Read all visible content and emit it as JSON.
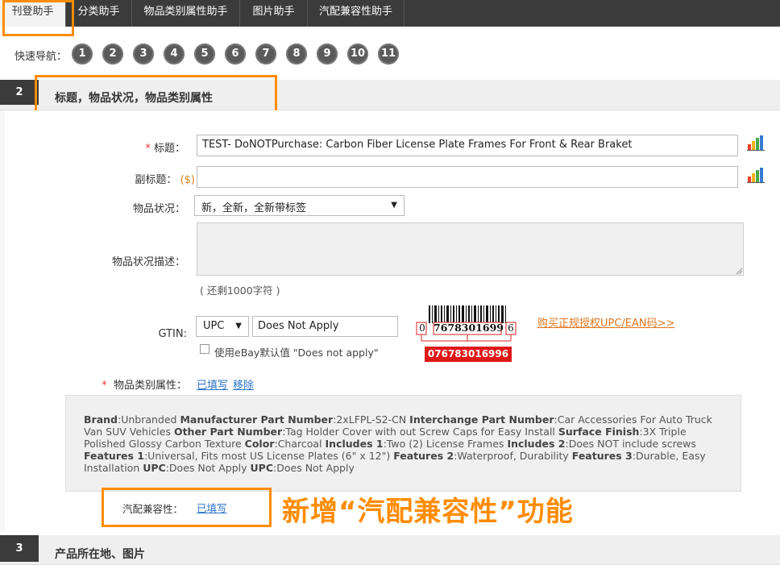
{
  "tabs": [
    {
      "label": "刊登助手",
      "active": true
    },
    {
      "label": "分类助手"
    },
    {
      "label": "物品类别属性助手"
    },
    {
      "label": "图片助手"
    },
    {
      "label": "汽配兼容性助手"
    }
  ],
  "quick_nav": {
    "label": "快速导航：",
    "items": [
      "1",
      "2",
      "3",
      "4",
      "5",
      "6",
      "7",
      "8",
      "9",
      "10",
      "11"
    ]
  },
  "section2": {
    "number": "2",
    "title": "标题，物品状况，物品类别属性"
  },
  "form": {
    "title_label": "标题：",
    "title_required": "*",
    "title_value": "TEST- DoNOTPurchase: Carbon Fiber License Plate Frames For Front & Rear Braket",
    "subtitle_label": "副标题：",
    "subtitle_price": "($)",
    "subtitle_value": "",
    "condition_label": "物品状况：",
    "condition_value": "新，全新，全新带标签",
    "condition_desc_label": "物品状况描述：",
    "chars_remaining": "( 还剩1000字符 )",
    "gtin_label": "GTIN:",
    "gtin_type": "UPC",
    "gtin_value": "Does Not Apply",
    "ebay_default": "使用eBay默认值 \"Does not apply\"",
    "buy_upc_link": "购买正规授权UPC/EAN码>>",
    "barcode_left": "0",
    "barcode_middle": "7678301699",
    "barcode_right": "6",
    "barcode_full": "076783016996",
    "category_attr_label": "物品类别属性：",
    "category_attr_required": "*",
    "filled_link": "已填写",
    "remove_link": "移除",
    "compat_label": "汽配兼容性：",
    "compat_filled": "已填写"
  },
  "attributes": [
    {
      "k": "Brand",
      "v": "Unbranded"
    },
    {
      "k": "Manufacturer Part Number",
      "v": "2xLFPL-S2-CN"
    },
    {
      "k": "Interchange Part Number",
      "v": "Car Accessories For Auto Truck Van SUV Vehicles"
    },
    {
      "k": "Other Part Number",
      "v": "Tag Holder Cover with out Screw Caps for Easy Install"
    },
    {
      "k": "Surface Finish",
      "v": "3X Triple Polished Glossy Carbon Texture"
    },
    {
      "k": "Color",
      "v": "Charcoal"
    },
    {
      "k": "Includes 1",
      "v": "Two (2) License Frames"
    },
    {
      "k": "Includes 2",
      "v": "Does NOT include screws"
    },
    {
      "k": "Features 1",
      "v": "Universal, Fits most US License Plates (6\" x 12\")"
    },
    {
      "k": "Features 2",
      "v": "Waterproof, Durability"
    },
    {
      "k": "Features 3",
      "v": "Durable, Easy Installation"
    },
    {
      "k": "UPC",
      "v": "Does Not Apply"
    },
    {
      "k": "UPC",
      "v": "Does Not Apply"
    }
  ],
  "annotation": "新增“汽配兼容性”功能",
  "section3": {
    "number": "3",
    "title": "产品所在地、图片"
  },
  "colors": {
    "accent": "#ff8c00",
    "dark": "#3b3b3b",
    "link": "#2a72c8"
  }
}
